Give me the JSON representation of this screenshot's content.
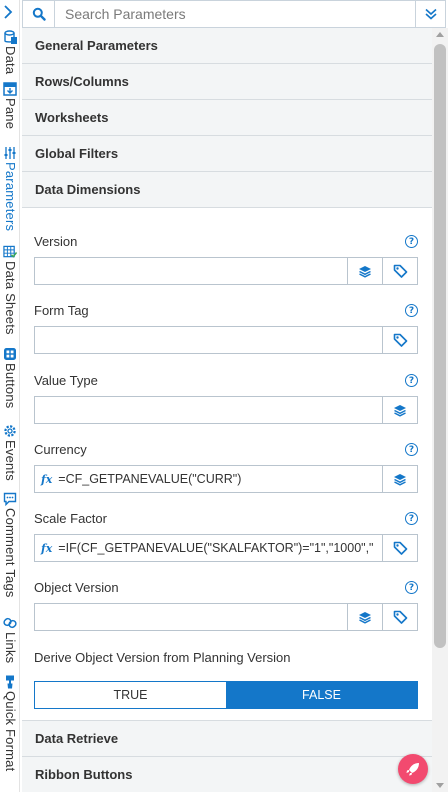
{
  "search": {
    "placeholder": "Search Parameters"
  },
  "side_tabs": [
    {
      "label": "Data",
      "icon": "database-icon"
    },
    {
      "label": "Pane",
      "icon": "pane-icon"
    },
    {
      "label": "Parameters",
      "icon": "sliders-icon",
      "active": true
    },
    {
      "label": "Data Sheets",
      "icon": "grid-check-icon"
    },
    {
      "label": "Buttons",
      "icon": "buttons-icon"
    },
    {
      "label": "Events",
      "icon": "gear-icon"
    },
    {
      "label": "Comment Tags",
      "icon": "comment-icon"
    },
    {
      "label": "Links",
      "icon": "link-icon"
    },
    {
      "label": "Quick Format",
      "icon": "brush-icon"
    }
  ],
  "sections": {
    "general": "General Parameters",
    "rows_columns": "Rows/Columns",
    "worksheets": "Worksheets",
    "global_filters": "Global Filters",
    "data_dimensions": "Data Dimensions",
    "data_retrieve": "Data Retrieve",
    "ribbon_buttons": "Ribbon Buttons"
  },
  "fields": {
    "version": {
      "label": "Version",
      "value": ""
    },
    "form_tag": {
      "label": "Form Tag",
      "value": ""
    },
    "value_type": {
      "label": "Value Type",
      "value": ""
    },
    "currency": {
      "label": "Currency",
      "value": "=CF_GETPANEVALUE(\"CURR\")"
    },
    "scale_factor": {
      "label": "Scale Factor",
      "value": "=IF(CF_GETPANEVALUE(\"SKALFAKTOR\")=\"1\",\"1000\",\""
    },
    "object_version": {
      "label": "Object Version",
      "value": ""
    }
  },
  "derive": {
    "label": "Derive Object Version from Planning Version",
    "true_label": "TRUE",
    "false_label": "FALSE",
    "selected": "FALSE"
  },
  "help_glyph": "?",
  "fx_glyph": "fx",
  "colors": {
    "accent": "#1477c9",
    "fab": "#f24a6f",
    "section_bg": "#f3f5f6"
  }
}
